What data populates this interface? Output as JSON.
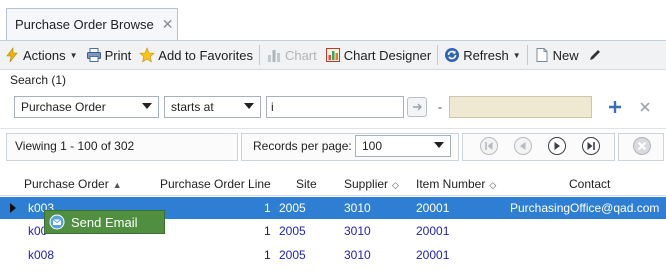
{
  "tab": {
    "title": "Purchase Order Browse",
    "close": "✕"
  },
  "toolbar": {
    "actions": "Actions",
    "print": "Print",
    "favorites": "Add to Favorites",
    "chart": "Chart",
    "chart_designer": "Chart Designer",
    "refresh": "Refresh",
    "new": "New"
  },
  "search": {
    "label": "Search (1)",
    "field_value": "Purchase Order",
    "operator_value": "starts at",
    "input_value": "i",
    "dash": "-"
  },
  "paging": {
    "viewing": "Viewing 1 - 100  of  302",
    "records_label": "Records per page:",
    "records_value": "100"
  },
  "grid": {
    "columns": {
      "purchase_order": "Purchase Order",
      "po_line": "Purchase Order Line",
      "site": "Site",
      "supplier": "Supplier",
      "item_number": "Item Number",
      "contact": "Contact"
    },
    "rows": [
      {
        "po": "k003",
        "line": "1",
        "site": "2005",
        "supplier": "3010",
        "item": "20001",
        "contact": "PurchasingOffice@qad.com"
      },
      {
        "po": "k00",
        "line": "1",
        "site": "2005",
        "supplier": "3010",
        "item": "20001",
        "contact": ""
      },
      {
        "po": "k008",
        "line": "1",
        "site": "2005",
        "supplier": "3010",
        "item": "20001",
        "contact": ""
      }
    ]
  },
  "context_menu": {
    "send_email": "Send Email"
  },
  "colors": {
    "selection": "#2e7fd4",
    "link": "#2323b5",
    "menu_bg": "#4f8f3f",
    "value_box": "#f0e9d2"
  }
}
